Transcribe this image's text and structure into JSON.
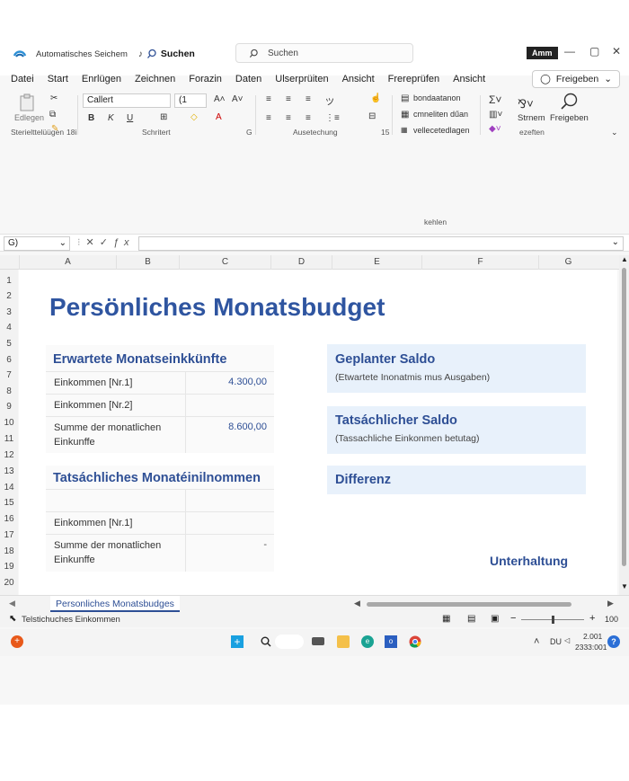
{
  "titlebar": {
    "autosave_label": "Automatisches Seichem",
    "search_label": "Suchen",
    "search_placeholder": "Suchen",
    "account": "Amm"
  },
  "menu": [
    "Datei",
    "Start",
    "Enrlügen",
    "Zeichnen",
    "Forazin",
    "Daten",
    "Ulserprüiten",
    "Ansicht",
    "Frereprüfen",
    "Ansicht"
  ],
  "share_label": "Freigeben",
  "ribbon": {
    "paste_label": "Edlegen",
    "clipboard_group": "Sterielttelüügen",
    "clipboard_group_suffix": "18i",
    "font_name": "Callert",
    "font_size": "(1",
    "font_group": "Schritert",
    "font_group_suffix": "G",
    "align_group": "Ausetechung",
    "align_group_suffix": "15",
    "styles": [
      "bondaatanon",
      "cmneliten dűan",
      "vellecetedlagen"
    ],
    "styles_group": "kehlen",
    "editing_group": "ezeften",
    "stream_label": "Strnem",
    "share_button": "Freigeben"
  },
  "formula": {
    "name_box": "G)"
  },
  "columns": [
    "A",
    "B",
    "C",
    "D",
    "E",
    "F",
    "G"
  ],
  "rows": [
    "1",
    "2",
    "3",
    "4",
    "5",
    "6",
    "7",
    "8",
    "9",
    "10",
    "11",
    "12",
    "13",
    "14",
    "15",
    "16",
    "17",
    "18",
    "19",
    "20"
  ],
  "sheet": {
    "title": "Persönliches Monatsbudget",
    "income_expected": {
      "heading": "Erwartete Monatseinkkünfte",
      "row1_label": "Einkommen [Nr.1]",
      "row1_value": "4.300,00",
      "row2_label": "Einkommen [Nr.2]",
      "sum_label_1": "Summe der monatlichen",
      "sum_label_2": "Einkunffe",
      "sum_value": "8.600,00"
    },
    "income_actual": {
      "heading": "Tatsáchliches Monatéinilnommen",
      "row1_label": "Einkommen [Nr.1]",
      "sum_label_1": "Summe der monatlichen",
      "sum_label_2": "Einkunffe",
      "sum_value": "-"
    },
    "cards": [
      {
        "heading": "Geplanter Saldo",
        "sub": "(Etwartete Inonatmis mus Ausgaben)"
      },
      {
        "heading": "Tatsáchlicher Saldo",
        "sub": "(Tassachliche Einkonmen betutag)"
      },
      {
        "heading": "Differenz",
        "sub": ""
      }
    ],
    "maintenance": "Unterhaltung"
  },
  "sheet_tab": "Personliches Monatsbudges",
  "status_text": "Telstichuches Einkommen",
  "zoom": "100",
  "tray": {
    "lang": "DU",
    "time": "2.001",
    "date": "2333:001"
  }
}
